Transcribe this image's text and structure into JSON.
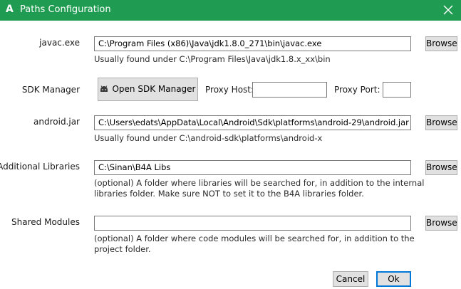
{
  "window": {
    "title": "Paths Configuration",
    "logo_letter": "A",
    "accent_color": "#1f9c52"
  },
  "javac": {
    "label": "javac.exe",
    "value": "C:\\Program Files (x86)\\Java\\jdk1.8.0_271\\bin\\javac.exe",
    "hint": "Usually found under C:\\Program Files\\Java\\jdk1.8.x_xx\\bin",
    "browse_label": "Browse"
  },
  "sdk": {
    "label": "SDK Manager",
    "button_label": "Open SDK Manager",
    "button_icon": "android-icon",
    "proxy_host_label": "Proxy Host:",
    "proxy_host_value": "",
    "proxy_port_label": "Proxy Port:",
    "proxy_port_value": ""
  },
  "android_jar": {
    "label": "android.jar",
    "value": "C:\\Users\\edats\\AppData\\Local\\Android\\Sdk\\platforms\\android-29\\android.jar",
    "hint": "Usually found under C:\\android-sdk\\platforms\\android-x",
    "browse_label": "Browse"
  },
  "additional_libraries": {
    "label": "Additional Libraries",
    "value": "C:\\Sinan\\B4A Libs",
    "hint_line1": "(optional) A folder where libraries will be searched for, in addition to the internal",
    "hint_line2": "libraries folder. Make sure NOT to set it to the B4A libraries folder.",
    "browse_label": "Browse"
  },
  "shared_modules": {
    "label": "Shared Modules",
    "value": "",
    "hint_line1": "(optional) A folder where code modules will be searched for, in addition to the",
    "hint_line2": "project folder.",
    "browse_label": "Browse"
  },
  "footer": {
    "cancel_label": "Cancel",
    "ok_label": "Ok"
  }
}
